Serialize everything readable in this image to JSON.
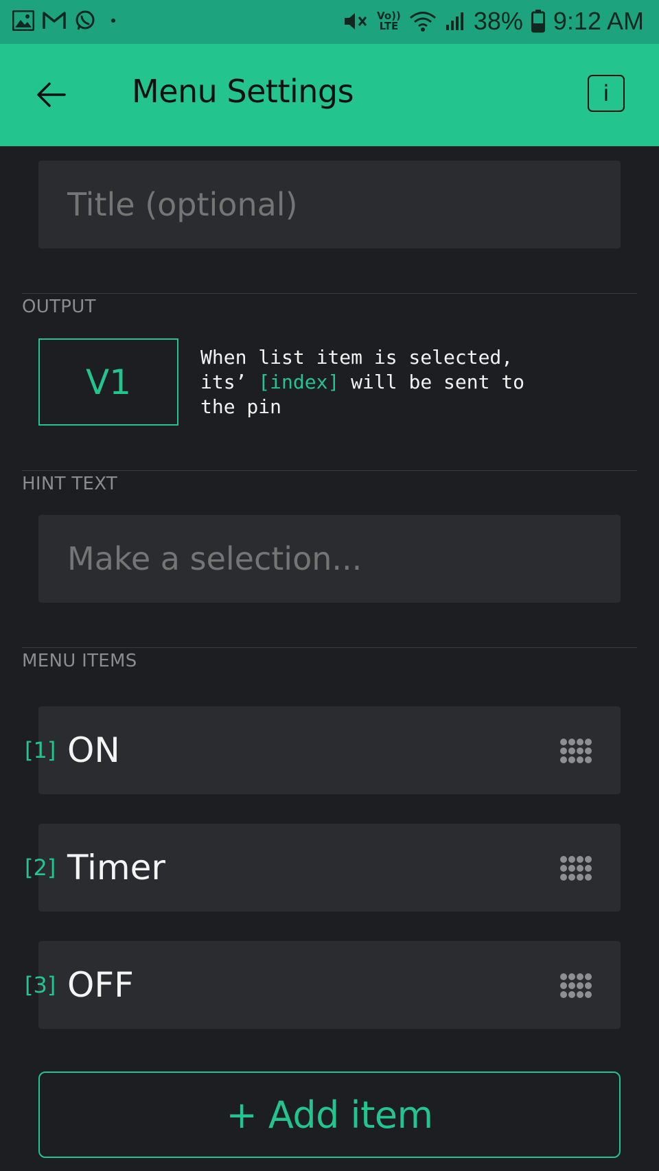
{
  "status_bar": {
    "left_icons": [
      "gallery-icon",
      "gmail-icon",
      "whatsapp-icon",
      "dot-icon"
    ],
    "volte_top": "Vo))",
    "volte_bottom": "LTE",
    "battery": "38%",
    "time": "9:12 AM"
  },
  "app_bar": {
    "title": "Menu Settings",
    "info_label": "i"
  },
  "title_field": {
    "placeholder": "Title (optional)"
  },
  "output": {
    "section_label": "OUTPUT",
    "pin": "V1",
    "desc_part1": "When list item is selected,\nits’ ",
    "desc_highlight": "[index]",
    "desc_part2": " will be sent to\nthe pin"
  },
  "hint": {
    "section_label": "HINT TEXT",
    "placeholder": "Make a selection..."
  },
  "menu": {
    "section_label": "MENU ITEMS",
    "items": [
      {
        "index": "[1]",
        "label": "ON"
      },
      {
        "index": "[2]",
        "label": "Timer"
      },
      {
        "index": "[3]",
        "label": "OFF"
      }
    ],
    "add_label": "+ Add item"
  },
  "colors": {
    "accent": "#23c48e",
    "status_bar_bg": "#1ea37f",
    "background": "#1d1e22",
    "field_bg": "#2b2c30"
  }
}
